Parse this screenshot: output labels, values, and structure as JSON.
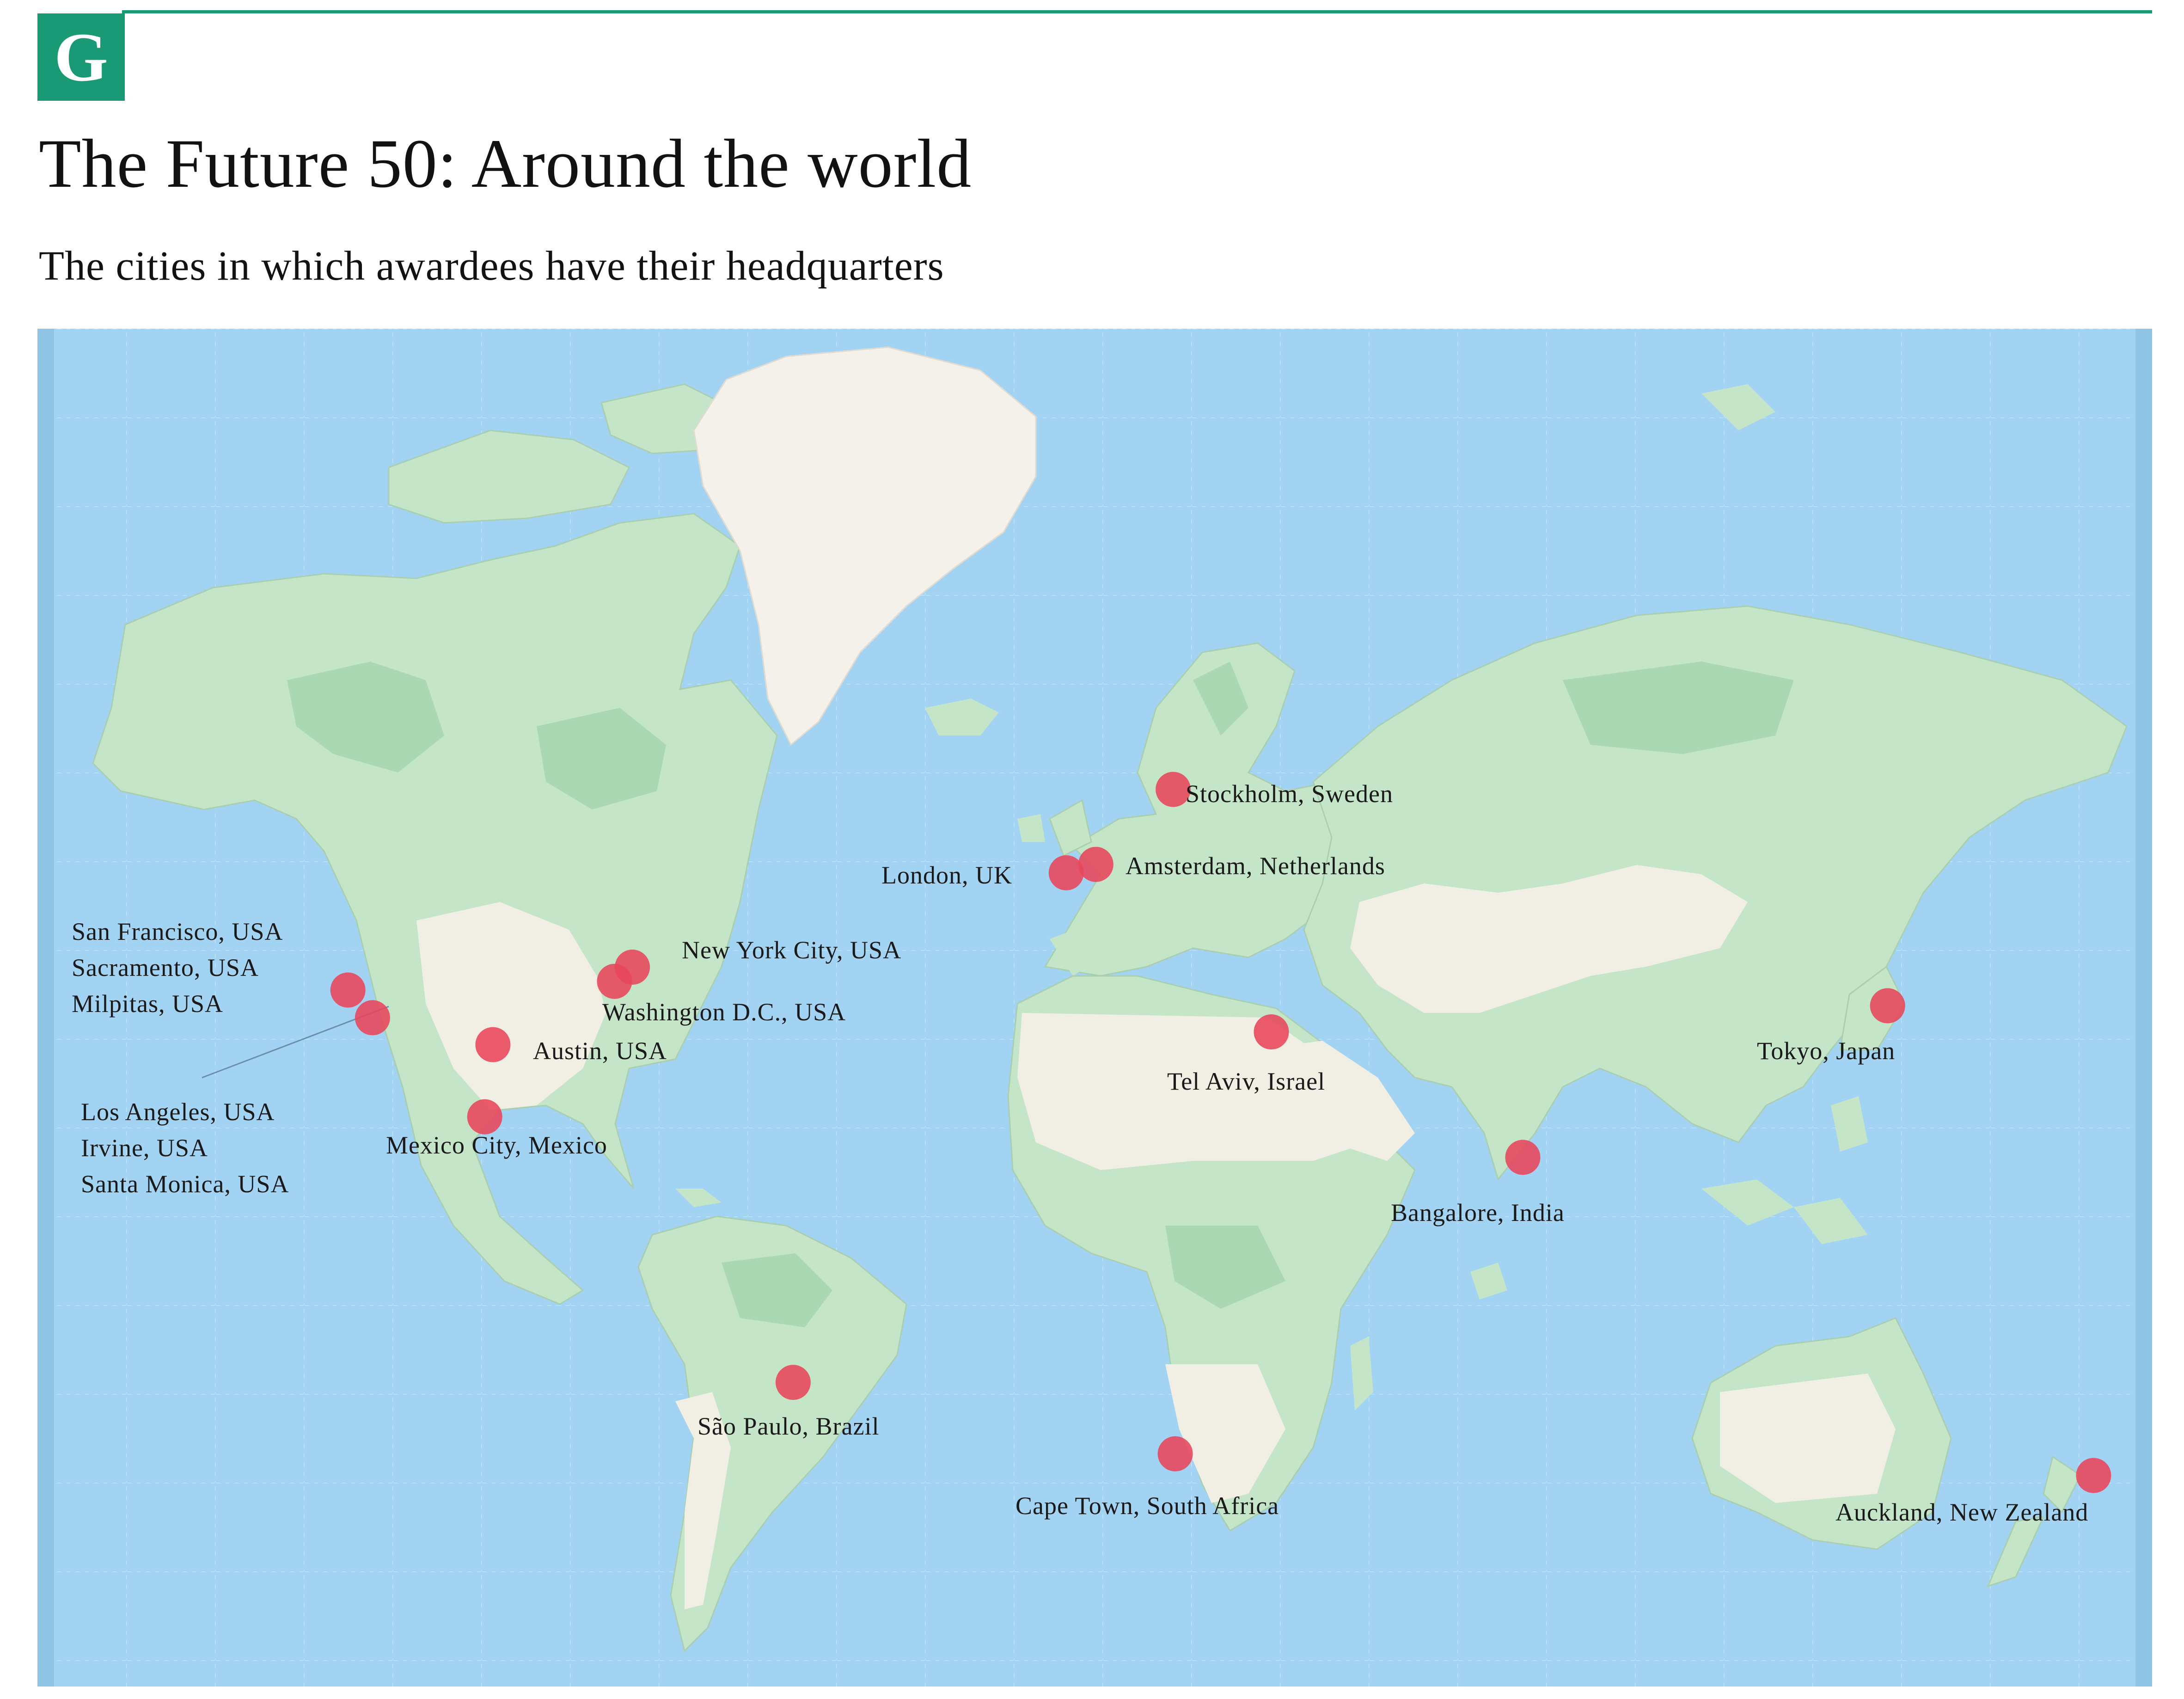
{
  "logo": {
    "letter": "G"
  },
  "header": {
    "title": "The Future 50: Around the world",
    "subtitle": "The cities in which awardees have their headquarters"
  },
  "colors": {
    "brand": "#1a9a74",
    "ocean": "#a3d3f2",
    "ocean_edge": "#8fc4e4",
    "land_green": "#c5e5c8",
    "land_dark_green": "#aad8b2",
    "land_dry": "#f1eee4",
    "greenland": "#f3f1ea",
    "marker": "#e8455a"
  },
  "map": {
    "projection": "mercator",
    "marker_groups": [
      {
        "id": "california",
        "lat": 37.77,
        "lon": -122.42
      },
      {
        "id": "socal",
        "lat": 34.05,
        "lon": -118.24
      },
      {
        "id": "austin",
        "lat": 30.27,
        "lon": -97.74
      },
      {
        "id": "mexico",
        "lat": 19.43,
        "lon": -99.13
      },
      {
        "id": "dc",
        "lat": 38.9,
        "lon": -77.04
      },
      {
        "id": "nyc",
        "lat": 40.71,
        "lon": -74.0
      },
      {
        "id": "saopaulo",
        "lat": -23.55,
        "lon": -46.63
      },
      {
        "id": "london",
        "lat": 51.51,
        "lon": -0.13
      },
      {
        "id": "amsterdam",
        "lat": 52.37,
        "lon": 4.9
      },
      {
        "id": "stockholm",
        "lat": 59.33,
        "lon": 18.07
      },
      {
        "id": "telaviv",
        "lat": 32.08,
        "lon": 34.78
      },
      {
        "id": "capetown",
        "lat": -33.92,
        "lon": 18.42
      },
      {
        "id": "bangalore",
        "lat": 12.97,
        "lon": 77.59
      },
      {
        "id": "tokyo",
        "lat": 35.68,
        "lon": 139.69
      },
      {
        "id": "auckland",
        "lat": -36.85,
        "lon": 174.76
      }
    ],
    "labels": {
      "california": [
        "San Francisco, USA",
        "Sacramento, USA",
        "Milpitas, USA"
      ],
      "socal": [
        "Los Angeles, USA",
        "Irvine, USA",
        "Santa Monica, USA"
      ],
      "austin": "Austin, USA",
      "mexico": "Mexico City, Mexico",
      "dc": "Washington D.C., USA",
      "nyc": "New York City, USA",
      "saopaulo": "São Paulo, Brazil",
      "london": "London, UK",
      "amsterdam": "Amsterdam, Netherlands",
      "stockholm": "Stockholm, Sweden",
      "telaviv": "Tel Aviv, Israel",
      "capetown": "Cape Town, South Africa",
      "bangalore": "Bangalore, India",
      "tokyo": "Tokyo, Japan",
      "auckland": "Auckland, New Zealand"
    }
  }
}
